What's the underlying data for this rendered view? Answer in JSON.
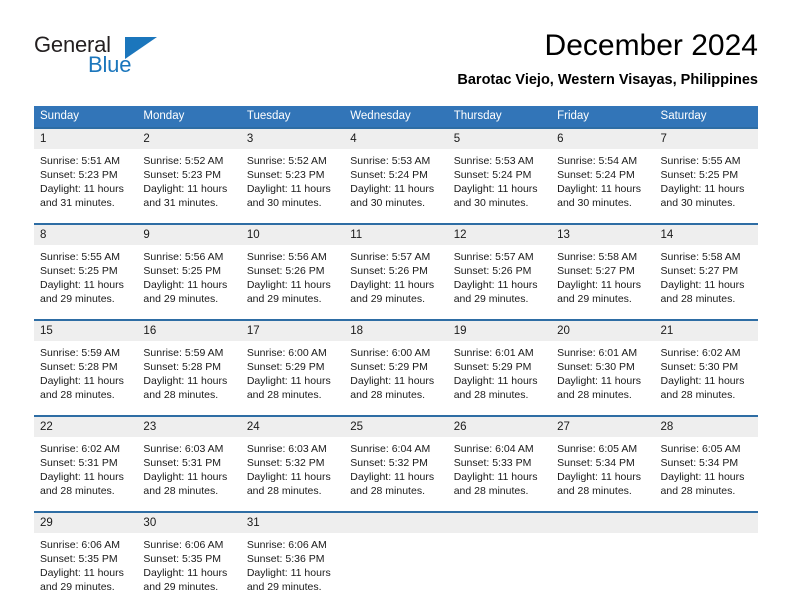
{
  "logo": {
    "primary_text": "General",
    "secondary_text": "Blue",
    "primary_color": "#231f20",
    "accent_color": "#1b76bc"
  },
  "header": {
    "title": "December 2024",
    "subtitle": "Barotac Viejo, Western Visayas, Philippines"
  },
  "theme": {
    "header_blue": "#3275b8",
    "rule_blue": "#2e6da4",
    "daynum_band": "#eeeeee"
  },
  "calendar": {
    "weekday_headers": [
      "Sunday",
      "Monday",
      "Tuesday",
      "Wednesday",
      "Thursday",
      "Friday",
      "Saturday"
    ],
    "weeks": [
      [
        {
          "day": "1",
          "sunrise": "Sunrise: 5:51 AM",
          "sunset": "Sunset: 5:23 PM",
          "daylight_line1": "Daylight: 11 hours",
          "daylight_line2": "and 31 minutes."
        },
        {
          "day": "2",
          "sunrise": "Sunrise: 5:52 AM",
          "sunset": "Sunset: 5:23 PM",
          "daylight_line1": "Daylight: 11 hours",
          "daylight_line2": "and 31 minutes."
        },
        {
          "day": "3",
          "sunrise": "Sunrise: 5:52 AM",
          "sunset": "Sunset: 5:23 PM",
          "daylight_line1": "Daylight: 11 hours",
          "daylight_line2": "and 30 minutes."
        },
        {
          "day": "4",
          "sunrise": "Sunrise: 5:53 AM",
          "sunset": "Sunset: 5:24 PM",
          "daylight_line1": "Daylight: 11 hours",
          "daylight_line2": "and 30 minutes."
        },
        {
          "day": "5",
          "sunrise": "Sunrise: 5:53 AM",
          "sunset": "Sunset: 5:24 PM",
          "daylight_line1": "Daylight: 11 hours",
          "daylight_line2": "and 30 minutes."
        },
        {
          "day": "6",
          "sunrise": "Sunrise: 5:54 AM",
          "sunset": "Sunset: 5:24 PM",
          "daylight_line1": "Daylight: 11 hours",
          "daylight_line2": "and 30 minutes."
        },
        {
          "day": "7",
          "sunrise": "Sunrise: 5:55 AM",
          "sunset": "Sunset: 5:25 PM",
          "daylight_line1": "Daylight: 11 hours",
          "daylight_line2": "and 30 minutes."
        }
      ],
      [
        {
          "day": "8",
          "sunrise": "Sunrise: 5:55 AM",
          "sunset": "Sunset: 5:25 PM",
          "daylight_line1": "Daylight: 11 hours",
          "daylight_line2": "and 29 minutes."
        },
        {
          "day": "9",
          "sunrise": "Sunrise: 5:56 AM",
          "sunset": "Sunset: 5:25 PM",
          "daylight_line1": "Daylight: 11 hours",
          "daylight_line2": "and 29 minutes."
        },
        {
          "day": "10",
          "sunrise": "Sunrise: 5:56 AM",
          "sunset": "Sunset: 5:26 PM",
          "daylight_line1": "Daylight: 11 hours",
          "daylight_line2": "and 29 minutes."
        },
        {
          "day": "11",
          "sunrise": "Sunrise: 5:57 AM",
          "sunset": "Sunset: 5:26 PM",
          "daylight_line1": "Daylight: 11 hours",
          "daylight_line2": "and 29 minutes."
        },
        {
          "day": "12",
          "sunrise": "Sunrise: 5:57 AM",
          "sunset": "Sunset: 5:26 PM",
          "daylight_line1": "Daylight: 11 hours",
          "daylight_line2": "and 29 minutes."
        },
        {
          "day": "13",
          "sunrise": "Sunrise: 5:58 AM",
          "sunset": "Sunset: 5:27 PM",
          "daylight_line1": "Daylight: 11 hours",
          "daylight_line2": "and 29 minutes."
        },
        {
          "day": "14",
          "sunrise": "Sunrise: 5:58 AM",
          "sunset": "Sunset: 5:27 PM",
          "daylight_line1": "Daylight: 11 hours",
          "daylight_line2": "and 28 minutes."
        }
      ],
      [
        {
          "day": "15",
          "sunrise": "Sunrise: 5:59 AM",
          "sunset": "Sunset: 5:28 PM",
          "daylight_line1": "Daylight: 11 hours",
          "daylight_line2": "and 28 minutes."
        },
        {
          "day": "16",
          "sunrise": "Sunrise: 5:59 AM",
          "sunset": "Sunset: 5:28 PM",
          "daylight_line1": "Daylight: 11 hours",
          "daylight_line2": "and 28 minutes."
        },
        {
          "day": "17",
          "sunrise": "Sunrise: 6:00 AM",
          "sunset": "Sunset: 5:29 PM",
          "daylight_line1": "Daylight: 11 hours",
          "daylight_line2": "and 28 minutes."
        },
        {
          "day": "18",
          "sunrise": "Sunrise: 6:00 AM",
          "sunset": "Sunset: 5:29 PM",
          "daylight_line1": "Daylight: 11 hours",
          "daylight_line2": "and 28 minutes."
        },
        {
          "day": "19",
          "sunrise": "Sunrise: 6:01 AM",
          "sunset": "Sunset: 5:29 PM",
          "daylight_line1": "Daylight: 11 hours",
          "daylight_line2": "and 28 minutes."
        },
        {
          "day": "20",
          "sunrise": "Sunrise: 6:01 AM",
          "sunset": "Sunset: 5:30 PM",
          "daylight_line1": "Daylight: 11 hours",
          "daylight_line2": "and 28 minutes."
        },
        {
          "day": "21",
          "sunrise": "Sunrise: 6:02 AM",
          "sunset": "Sunset: 5:30 PM",
          "daylight_line1": "Daylight: 11 hours",
          "daylight_line2": "and 28 minutes."
        }
      ],
      [
        {
          "day": "22",
          "sunrise": "Sunrise: 6:02 AM",
          "sunset": "Sunset: 5:31 PM",
          "daylight_line1": "Daylight: 11 hours",
          "daylight_line2": "and 28 minutes."
        },
        {
          "day": "23",
          "sunrise": "Sunrise: 6:03 AM",
          "sunset": "Sunset: 5:31 PM",
          "daylight_line1": "Daylight: 11 hours",
          "daylight_line2": "and 28 minutes."
        },
        {
          "day": "24",
          "sunrise": "Sunrise: 6:03 AM",
          "sunset": "Sunset: 5:32 PM",
          "daylight_line1": "Daylight: 11 hours",
          "daylight_line2": "and 28 minutes."
        },
        {
          "day": "25",
          "sunrise": "Sunrise: 6:04 AM",
          "sunset": "Sunset: 5:32 PM",
          "daylight_line1": "Daylight: 11 hours",
          "daylight_line2": "and 28 minutes."
        },
        {
          "day": "26",
          "sunrise": "Sunrise: 6:04 AM",
          "sunset": "Sunset: 5:33 PM",
          "daylight_line1": "Daylight: 11 hours",
          "daylight_line2": "and 28 minutes."
        },
        {
          "day": "27",
          "sunrise": "Sunrise: 6:05 AM",
          "sunset": "Sunset: 5:34 PM",
          "daylight_line1": "Daylight: 11 hours",
          "daylight_line2": "and 28 minutes."
        },
        {
          "day": "28",
          "sunrise": "Sunrise: 6:05 AM",
          "sunset": "Sunset: 5:34 PM",
          "daylight_line1": "Daylight: 11 hours",
          "daylight_line2": "and 28 minutes."
        }
      ],
      [
        {
          "day": "29",
          "sunrise": "Sunrise: 6:06 AM",
          "sunset": "Sunset: 5:35 PM",
          "daylight_line1": "Daylight: 11 hours",
          "daylight_line2": "and 29 minutes."
        },
        {
          "day": "30",
          "sunrise": "Sunrise: 6:06 AM",
          "sunset": "Sunset: 5:35 PM",
          "daylight_line1": "Daylight: 11 hours",
          "daylight_line2": "and 29 minutes."
        },
        {
          "day": "31",
          "sunrise": "Sunrise: 6:06 AM",
          "sunset": "Sunset: 5:36 PM",
          "daylight_line1": "Daylight: 11 hours",
          "daylight_line2": "and 29 minutes."
        },
        {
          "day": "",
          "sunrise": "",
          "sunset": "",
          "daylight_line1": "",
          "daylight_line2": ""
        },
        {
          "day": "",
          "sunrise": "",
          "sunset": "",
          "daylight_line1": "",
          "daylight_line2": ""
        },
        {
          "day": "",
          "sunrise": "",
          "sunset": "",
          "daylight_line1": "",
          "daylight_line2": ""
        },
        {
          "day": "",
          "sunrise": "",
          "sunset": "",
          "daylight_line1": "",
          "daylight_line2": ""
        }
      ]
    ]
  }
}
